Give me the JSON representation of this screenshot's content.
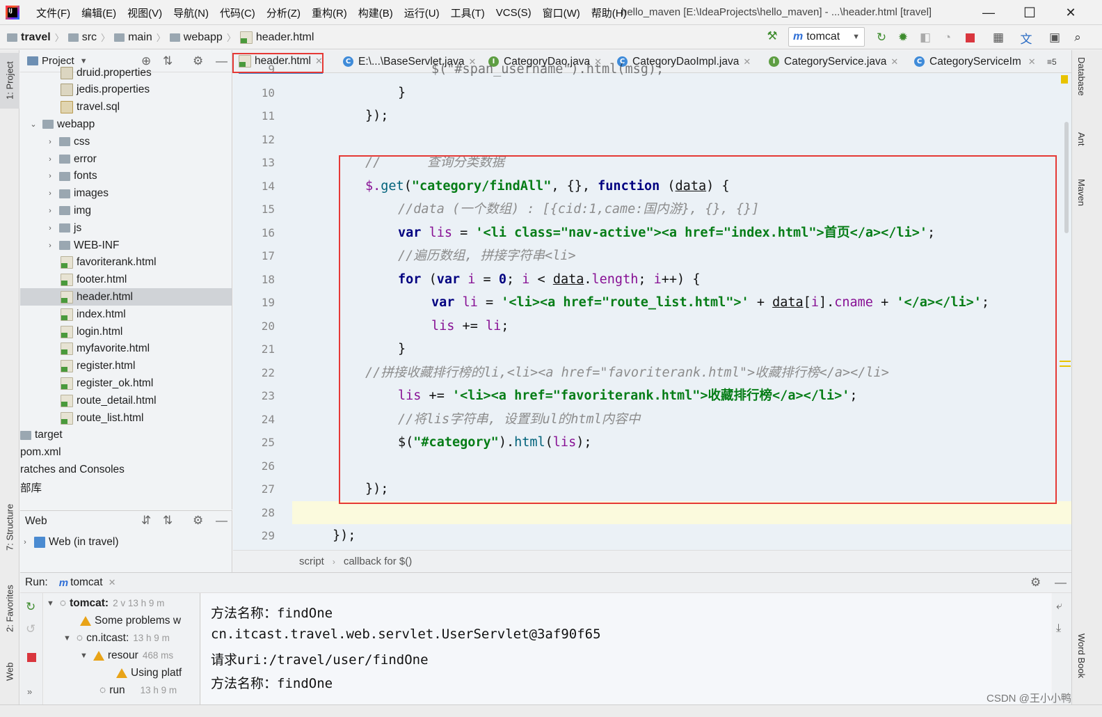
{
  "app": {
    "logo_text": "IJ",
    "window_title": "hello_maven [E:\\IdeaProjects\\hello_maven] - ...\\header.html [travel]",
    "menu": [
      "文件(F)",
      "编辑(E)",
      "视图(V)",
      "导航(N)",
      "代码(C)",
      "分析(Z)",
      "重构(R)",
      "构建(B)",
      "运行(U)",
      "工具(T)",
      "VCS(S)",
      "窗口(W)",
      "帮助(H)"
    ],
    "minimize": "—",
    "maximize": "☐",
    "close": "✕"
  },
  "navbar": {
    "breadcrumb": [
      "travel",
      "src",
      "main",
      "webapp",
      "header.html"
    ],
    "run_config": "tomcat"
  },
  "left_stripe": {
    "tabs": [
      "1: Project",
      "7: Structure",
      "2: Favorites",
      "Web"
    ]
  },
  "project_panel": {
    "title": "Project",
    "items": [
      {
        "label": "druid.properties",
        "type": "prop"
      },
      {
        "label": "jedis.properties",
        "type": "prop"
      },
      {
        "label": "travel.sql",
        "type": "sql"
      },
      {
        "label": "webapp",
        "type": "folder"
      },
      {
        "label": "css",
        "type": "folder"
      },
      {
        "label": "error",
        "type": "folder"
      },
      {
        "label": "fonts",
        "type": "folder"
      },
      {
        "label": "images",
        "type": "folder"
      },
      {
        "label": "img",
        "type": "folder"
      },
      {
        "label": "js",
        "type": "folder"
      },
      {
        "label": "WEB-INF",
        "type": "folder"
      },
      {
        "label": "favoriterank.html",
        "type": "html"
      },
      {
        "label": "footer.html",
        "type": "html"
      },
      {
        "label": "header.html",
        "type": "html"
      },
      {
        "label": "index.html",
        "type": "html"
      },
      {
        "label": "login.html",
        "type": "html"
      },
      {
        "label": "myfavorite.html",
        "type": "html"
      },
      {
        "label": "register.html",
        "type": "html"
      },
      {
        "label": "register_ok.html",
        "type": "html"
      },
      {
        "label": "route_detail.html",
        "type": "html"
      },
      {
        "label": "route_list.html",
        "type": "html"
      },
      {
        "label": "target",
        "type": "folder"
      },
      {
        "label": "pom.xml",
        "type": "xml"
      },
      {
        "label": "ratches and Consoles",
        "type": "text"
      },
      {
        "label": "部库",
        "type": "text"
      }
    ]
  },
  "web_panel": {
    "title": "Web",
    "item": "Web (in travel)"
  },
  "editor": {
    "tabs": [
      {
        "label": "header.html",
        "icon": "H"
      },
      {
        "label": "E:\\...\\BaseServlet.java",
        "icon": "C"
      },
      {
        "label": "CategoryDao.java",
        "icon": "I"
      },
      {
        "label": "CategoryDaoImpl.java",
        "icon": "C"
      },
      {
        "label": "CategoryService.java",
        "icon": "I"
      },
      {
        "label": "CategoryServiceIm",
        "icon": "C"
      }
    ],
    "tab_overflow": "≡5",
    "line_numbers": [
      "9",
      "10",
      "11",
      "12",
      "13",
      "14",
      "15",
      "16",
      "17",
      "18",
      "19",
      "20",
      "21",
      "22",
      "23",
      "24",
      "25",
      "26",
      "27",
      "28",
      "29"
    ],
    "code": {
      "l9": "$(\"#span_username\").html(msg);",
      "l10": "}",
      "l11": "});",
      "l13a": "//",
      "l13b": "查询分类数据",
      "l14a": "$.",
      "l14b": "get",
      "l14c": "(",
      "l14d": "\"category/findAll\"",
      "l14e": ", {}, ",
      "l14f": "function ",
      "l14g": "(",
      "l14h": "data",
      "l14i": ") {",
      "l15": "//data (一个数组) : [{cid:1,came:国内游}, {}, {}]",
      "l16a": "var ",
      "l16b": "lis",
      "l16c": " = ",
      "l16d": "'<li class=\"nav-active\"><a href=\"index.html\">首页</a></li>'",
      "l16e": ";",
      "l17": "//遍历数组, 拼接字符串<li>",
      "l18a": "for ",
      "l18b": "(",
      "l18c": "var ",
      "l18d": "i",
      "l18e": " = ",
      "l18f": "0",
      "l18g": "; ",
      "l18h": "i",
      "l18i": " < ",
      "l18j": "data",
      "l18k": ".",
      "l18l": "length",
      "l18m": "; ",
      "l18n": "i",
      "l18o": "++) {",
      "l19a": "var ",
      "l19b": "li",
      "l19c": " = ",
      "l19d": "'<li><a href=\"route_list.html\">'",
      "l19e": " + ",
      "l19f": "data",
      "l19g": "[",
      "l19h": "i",
      "l19i": "].",
      "l19j": "cname",
      "l19k": " + ",
      "l19l": "'</a></li>'",
      "l19m": ";",
      "l20a": "lis",
      "l20b": " += ",
      "l20c": "li",
      "l20d": ";",
      "l21": "}",
      "l22": "//拼接收藏排行榜的li,<li><a href=\"favoriterank.html\">收藏排行榜</a></li>",
      "l23a": "lis",
      "l23b": " += ",
      "l23c": "'<li><a href=\"favoriterank.html\">收藏排行榜</a></li>'",
      "l23d": ";",
      "l24": "//将lis字符串, 设置到ul的html内容中",
      "l25a": "$(",
      "l25b": "\"#category\"",
      "l25c": ").",
      "l25d": "html",
      "l25e": "(",
      "l25f": "lis",
      "l25g": ");",
      "l27": "});",
      "l29": "});"
    },
    "breadcrumb": [
      "script",
      "callback for $()"
    ]
  },
  "right_stripe": {
    "tabs": [
      "Database",
      "Ant",
      "Maven",
      "Word Book"
    ]
  },
  "run_panel": {
    "label": "Run:",
    "tab": "tomcat",
    "tree": [
      {
        "label": "tomcat:",
        "extra": "2 v 13 h 9 m"
      },
      {
        "label": "Some problems w",
        "extra": ""
      },
      {
        "label": "cn.itcast:",
        "extra": "13 h 9 m"
      },
      {
        "label": "resour",
        "extra": "468 ms"
      },
      {
        "label": "Using platf",
        "extra": ""
      },
      {
        "label": "run",
        "extra": "13 h 9 m"
      }
    ],
    "console": [
      "方法名称：findOne",
      "cn.itcast.travel.web.servlet.UserServlet@3af90f65",
      "请求uri:/travel/user/findOne",
      "方法名称：findOne"
    ]
  },
  "watermark": "CSDN @王小小鸭"
}
